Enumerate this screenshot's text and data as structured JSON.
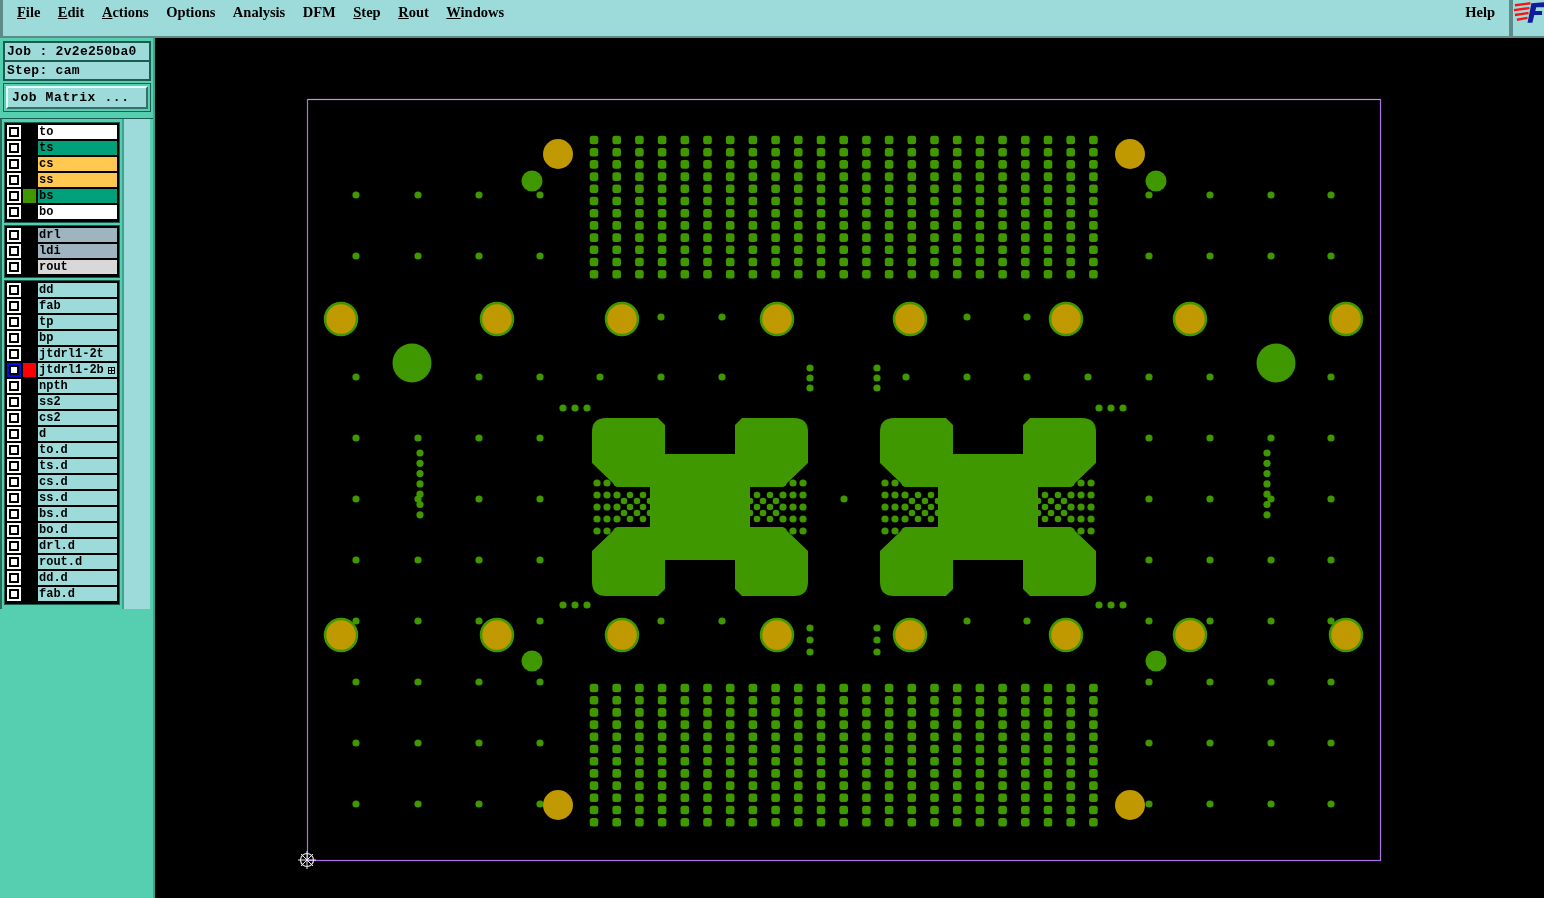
{
  "menu_bar": {
    "items": [
      {
        "label": "File",
        "underlined": true
      },
      {
        "label": "Edit",
        "underlined": true
      },
      {
        "label": "Actions",
        "underlined": true
      },
      {
        "label": "Options",
        "underlined": false
      },
      {
        "label": "Analysis",
        "underlined": false
      },
      {
        "label": "DFM",
        "underlined": false
      },
      {
        "label": "Step",
        "underlined": true
      },
      {
        "label": "Rout",
        "underlined": true
      },
      {
        "label": "Windows",
        "underlined": true
      }
    ],
    "help": "Help"
  },
  "job_panel": {
    "job": "Job : 2v2e250ba0",
    "step": "Step: cam",
    "matrix_button": "Job Matrix ..."
  },
  "layer_groups": [
    {
      "layers": [
        {
          "name": "to",
          "color": "#ffffff",
          "work_layer": false,
          "attached": false
        },
        {
          "name": "ts",
          "color": "#00a07a",
          "work_layer": false,
          "attached": false
        },
        {
          "name": "cs",
          "color": "#ffc850",
          "work_layer": false,
          "attached": false
        },
        {
          "name": "ss",
          "color": "#ffc850",
          "work_layer": false,
          "attached": false
        },
        {
          "name": "bs",
          "color": "#00a07a",
          "work_layer": false,
          "display": {
            "color": "#409800"
          },
          "attached": false
        },
        {
          "name": "bo",
          "color": "#ffffff",
          "work_layer": false,
          "attached": false
        }
      ]
    },
    {
      "layers": [
        {
          "name": "drl",
          "color": "#9eb4be",
          "work_layer": false,
          "attached": false
        },
        {
          "name": "ldi",
          "color": "#9eb4be",
          "work_layer": false,
          "attached": false
        },
        {
          "name": "rout",
          "color": "#d8d8d8",
          "work_layer": false,
          "attached": false
        }
      ]
    },
    {
      "layers": [
        {
          "name": "dd",
          "color": "#9ddbdb",
          "work_layer": false,
          "attached": false
        },
        {
          "name": "fab",
          "color": "#9ddbdb",
          "work_layer": false,
          "attached": false
        },
        {
          "name": "tp",
          "color": "#9ddbdb",
          "work_layer": false,
          "attached": false
        },
        {
          "name": "bp",
          "color": "#9ddbdb",
          "work_layer": false,
          "attached": false
        },
        {
          "name": "jtdrl1-2t",
          "color": "#9ddbdb",
          "work_layer": false,
          "attached": false
        },
        {
          "name": "jtdrl1-2b",
          "color": "#9ddbdb",
          "work_layer": true,
          "display": {
            "color": "#ff0000"
          },
          "attached": true
        },
        {
          "name": "npth",
          "color": "#9ddbdb",
          "work_layer": false,
          "attached": false
        },
        {
          "name": "ss2",
          "color": "#9ddbdb",
          "work_layer": false,
          "attached": false
        },
        {
          "name": "cs2",
          "color": "#9ddbdb",
          "work_layer": false,
          "attached": false
        },
        {
          "name": "d",
          "color": "#9ddbdb",
          "work_layer": false,
          "attached": false
        },
        {
          "name": "to.d",
          "color": "#9ddbdb",
          "work_layer": false,
          "attached": false
        },
        {
          "name": "ts.d",
          "color": "#9ddbdb",
          "work_layer": false,
          "attached": false
        },
        {
          "name": "cs.d",
          "color": "#9ddbdb",
          "work_layer": false,
          "attached": false
        },
        {
          "name": "ss.d",
          "color": "#9ddbdb",
          "work_layer": false,
          "attached": false
        },
        {
          "name": "bs.d",
          "color": "#9ddbdb",
          "work_layer": false,
          "attached": false
        },
        {
          "name": "bo.d",
          "color": "#9ddbdb",
          "work_layer": false,
          "attached": false
        },
        {
          "name": "drl.d",
          "color": "#9ddbdb",
          "work_layer": false,
          "attached": false
        },
        {
          "name": "rout.d",
          "color": "#9ddbdb",
          "work_layer": false,
          "attached": false
        },
        {
          "name": "dd.d",
          "color": "#9ddbdb",
          "work_layer": false,
          "attached": false
        },
        {
          "name": "fab.d",
          "color": "#9ddbdb",
          "work_layer": false,
          "attached": false
        }
      ]
    }
  ]
}
